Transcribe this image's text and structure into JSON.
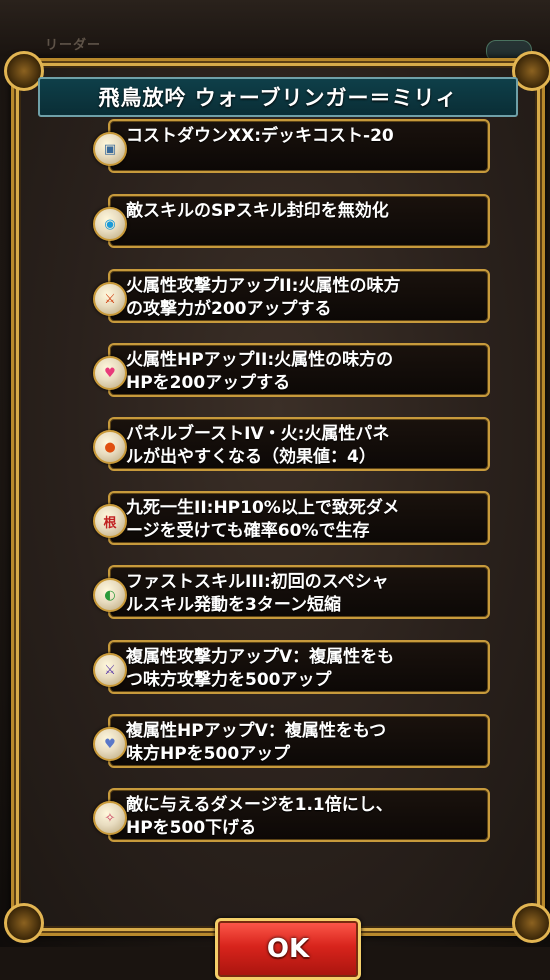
{
  "background": {
    "label": "リーダー"
  },
  "dialog": {
    "title": "飛鳥放吟 ウォーブリンガー＝ミリィ",
    "skills": [
      {
        "text": "コストダウンXX:デッキコスト-20",
        "icon": "cost-card-icon",
        "glyph": "▣",
        "color": "#3a6a9a"
      },
      {
        "text": "敵スキルのSPスキル封印を無効化",
        "icon": "blue-orb-icon",
        "glyph": "◉",
        "color": "#1a9ad8"
      },
      {
        "text": "火属性攻撃力アップII:火属性の味方の攻撃力が200アップする",
        "icon": "fire-sword-icon",
        "glyph": "⚔",
        "color": "#d04010"
      },
      {
        "text": "火属性HPアップII:火属性の味方のHPを200アップする",
        "icon": "heart-icon",
        "glyph": "♥",
        "color": "#e83a7a"
      },
      {
        "text": "パネルブーストIV・火:火属性パネルが出やすくなる（効果値：4）",
        "icon": "fire-orb-icon",
        "glyph": "●",
        "color": "#e05010"
      },
      {
        "text": "九死一生II:HP10%以上で致死ダメージを受けても確率60%で生存",
        "icon": "endure-icon",
        "glyph": "根",
        "color": "#c02020"
      },
      {
        "text": "ファストスキルIII:初回のスペシャルスキル発動を3ターン短縮",
        "icon": "fast-skill-icon",
        "glyph": "◐",
        "color": "#2a9a3a"
      },
      {
        "text": "複属性攻撃力アップV：複属性をもつ味方攻撃力を500アップ",
        "icon": "multi-sword-icon",
        "glyph": "⚔",
        "color": "#5a3aa8"
      },
      {
        "text": "複属性HPアップV：複属性をもつ味方HPを500アップ",
        "icon": "multi-heart-icon",
        "glyph": "♥",
        "color": "#5a78c8"
      },
      {
        "text": "敵に与えるダメージを1.1倍にし、HPを500下げる",
        "icon": "damage-up-icon",
        "glyph": "✧",
        "color": "#c83a5a"
      }
    ],
    "skill_lines": [
      [
        "コストダウンXX:デッキコスト-20"
      ],
      [
        "敵スキルのSPスキル封印を無効化"
      ],
      [
        "火属性攻撃力アップII:火属性の味方",
        "の攻撃力が200アップする"
      ],
      [
        "火属性HPアップII:火属性の味方の",
        "HPを200アップする"
      ],
      [
        "パネルブーストIV・火:火属性パネ",
        "ルが出やすくなる（効果値：4）"
      ],
      [
        "九死一生II:HP10%以上で致死ダメ",
        "ージを受けても確率60%で生存"
      ],
      [
        "ファストスキルIII:初回のスペシャ",
        "ルスキル発動を3ターン短縮"
      ],
      [
        "複属性攻撃力アップV：複属性をも",
        "つ味方攻撃力を500アップ"
      ],
      [
        "複属性HPアップV：複属性をもつ",
        "味方HPを500アップ"
      ],
      [
        "敵に与えるダメージを1.1倍にし、",
        "HPを500下げる"
      ]
    ],
    "ok_label": "OK"
  }
}
